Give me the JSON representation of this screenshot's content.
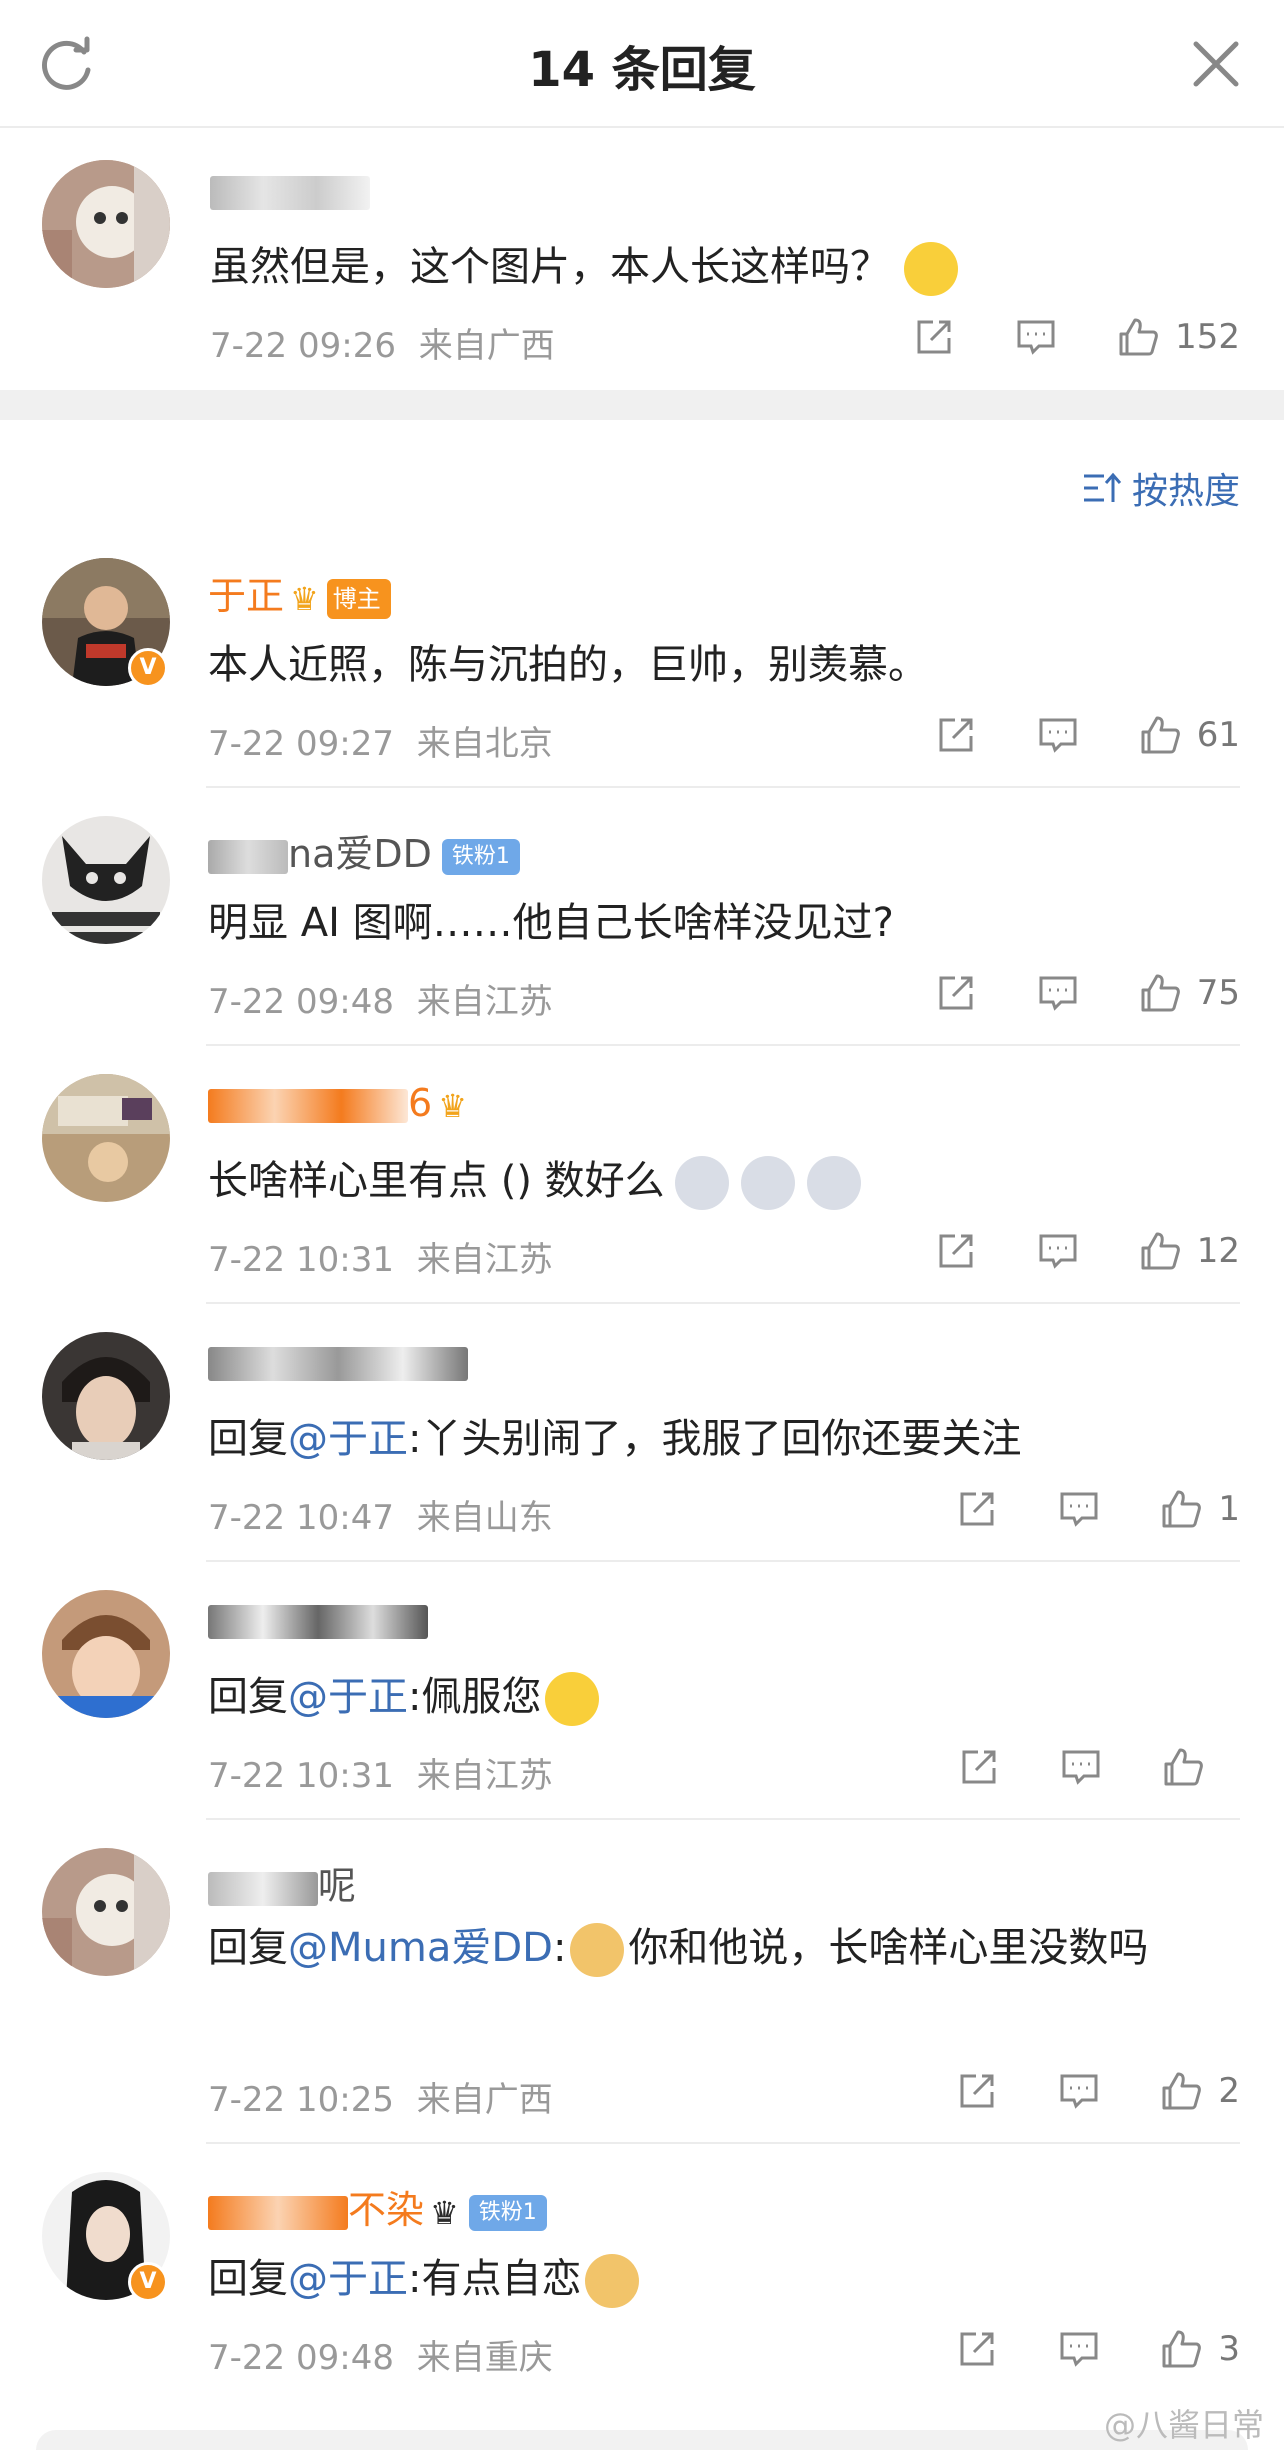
{
  "header": {
    "title": "14 条回复"
  },
  "root": {
    "user": {
      "name_suffix": ""
    },
    "text": "虽然但是，这个图片，本人长这样吗？",
    "time": "7-22 09:26",
    "location": "来自广西",
    "likes": "152"
  },
  "sort": {
    "label": "按热度"
  },
  "replies": [
    {
      "name": "于正",
      "badge": "博主",
      "text": "本人近照，陈与沉拍的，巨帅，别羡慕。",
      "time": "7-22 09:27",
      "location": "来自北京",
      "likes": "61"
    },
    {
      "name_suffix": "na爱DD",
      "badge": "铁粉1",
      "text": "明显 AI 图啊……他自己长啥样没见过?",
      "time": "7-22 09:48",
      "location": "来自江苏",
      "likes": "75"
    },
    {
      "name_suffix": "6",
      "text": "长啥样心里有点 () 数好么",
      "time": "7-22 10:31",
      "location": "来自江苏",
      "likes": "12"
    },
    {
      "prefix": "回复",
      "mention": "@于正",
      "text": ":丫头别闹了，我服了回你还要关注",
      "time": "7-22 10:47",
      "location": "来自山东",
      "likes": "1"
    },
    {
      "prefix": "回复",
      "mention": "@于正",
      "text": ":佩服您",
      "time": "7-22 10:31",
      "location": "来自江苏",
      "likes": ""
    },
    {
      "name_suffix": "呢",
      "prefix": "回复",
      "mention": "@Muma爱DD",
      "text": "你和他说，长啥样心里没数吗",
      "time": "7-22 10:25",
      "location": "来自广西",
      "likes": "2"
    },
    {
      "name_suffix": "不染",
      "badge": "铁粉1",
      "prefix": "回复",
      "mention": "@于正",
      "text": ":有点自恋",
      "time": "7-22 09:48",
      "location": "来自重庆",
      "likes": "3"
    }
  ],
  "watermark": "@八酱日常",
  "colors": {
    "mention": "#3b6db4",
    "name_orange": "#f47b1e",
    "meta": "#999999",
    "badge_orange": "#f7931e",
    "badge_blue": "#6fa8e8"
  }
}
